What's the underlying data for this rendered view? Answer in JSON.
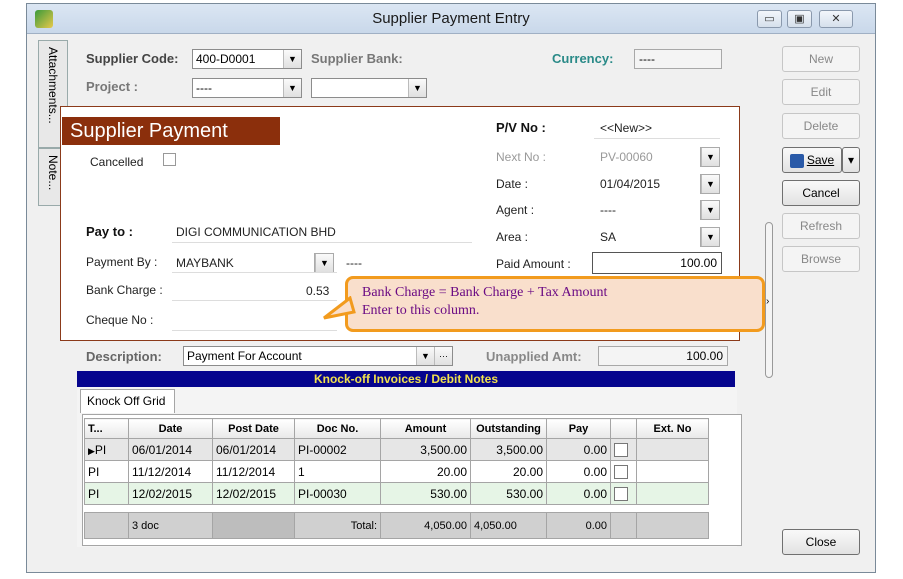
{
  "window": {
    "title": "Supplier Payment Entry"
  },
  "sidetabs": [
    "Attachments...",
    "Note..."
  ],
  "header": {
    "supplier_code_label": "Supplier Code:",
    "supplier_code": "400-D0001",
    "supplier_bank_label": "Supplier Bank:",
    "currency_label": "Currency:",
    "currency_value": "----",
    "project_label": "Project :",
    "project_value": "----"
  },
  "panel": {
    "title": "Supplier Payment",
    "cancelled_label": "Cancelled",
    "pay_to_label": "Pay to :",
    "pay_to_value": "DIGI COMMUNICATION BHD",
    "payment_by_label": "Payment By :",
    "payment_by_value": "MAYBANK",
    "payment_by_extra": "----",
    "bank_charge_label": "Bank Charge :",
    "bank_charge_value": "0.53",
    "cheque_no_label": "Cheque No :",
    "pv_no_label": "P/V No :",
    "pv_no_value": "<<New>>",
    "next_no_label": "Next No :",
    "next_no_value": "PV-00060",
    "date_label": "Date :",
    "date_value": "01/04/2015",
    "agent_label": "Agent :",
    "agent_value": "----",
    "area_label": "Area :",
    "area_value": "SA",
    "paid_amount_label": "Paid Amount :",
    "paid_amount_value": "100.00"
  },
  "callout": {
    "line1": "Bank Charge = Bank Charge + Tax Amount",
    "line2": "Enter to this column."
  },
  "description": {
    "label": "Description:",
    "value": "Payment For Account",
    "ellipsis": "···",
    "unapplied_label": "Unapplied Amt:",
    "unapplied_value": "100.00"
  },
  "knockoff": {
    "banner": "Knock-off Invoices / Debit Notes",
    "tab_label": "Knock Off Grid",
    "columns": [
      "T...",
      "Date",
      "Post Date",
      "Doc No.",
      "Amount",
      "Outstanding",
      "Pay",
      "",
      "Ext. No"
    ],
    "rows": [
      {
        "t": "PI",
        "date": "06/01/2014",
        "post": "06/01/2014",
        "doc": "PI-00002",
        "amount": "3,500.00",
        "outstanding": "3,500.00",
        "pay": "0.00"
      },
      {
        "t": "PI",
        "date": "11/12/2014",
        "post": "11/12/2014",
        "doc": "1",
        "amount": "20.00",
        "outstanding": "20.00",
        "pay": "0.00"
      },
      {
        "t": "PI",
        "date": "12/02/2015",
        "post": "12/02/2015",
        "doc": "PI-00030",
        "amount": "530.00",
        "outstanding": "530.00",
        "pay": "0.00"
      }
    ],
    "footer": {
      "count": "3 doc",
      "total_label": "Total:",
      "amount": "4,050.00",
      "outstanding": "4,050.00",
      "pay": "0.00"
    }
  },
  "buttons": {
    "new": "New",
    "edit": "Edit",
    "delete": "Delete",
    "save": "Save",
    "cancel": "Cancel",
    "refresh": "Refresh",
    "browse": "Browse",
    "close": "Close"
  }
}
